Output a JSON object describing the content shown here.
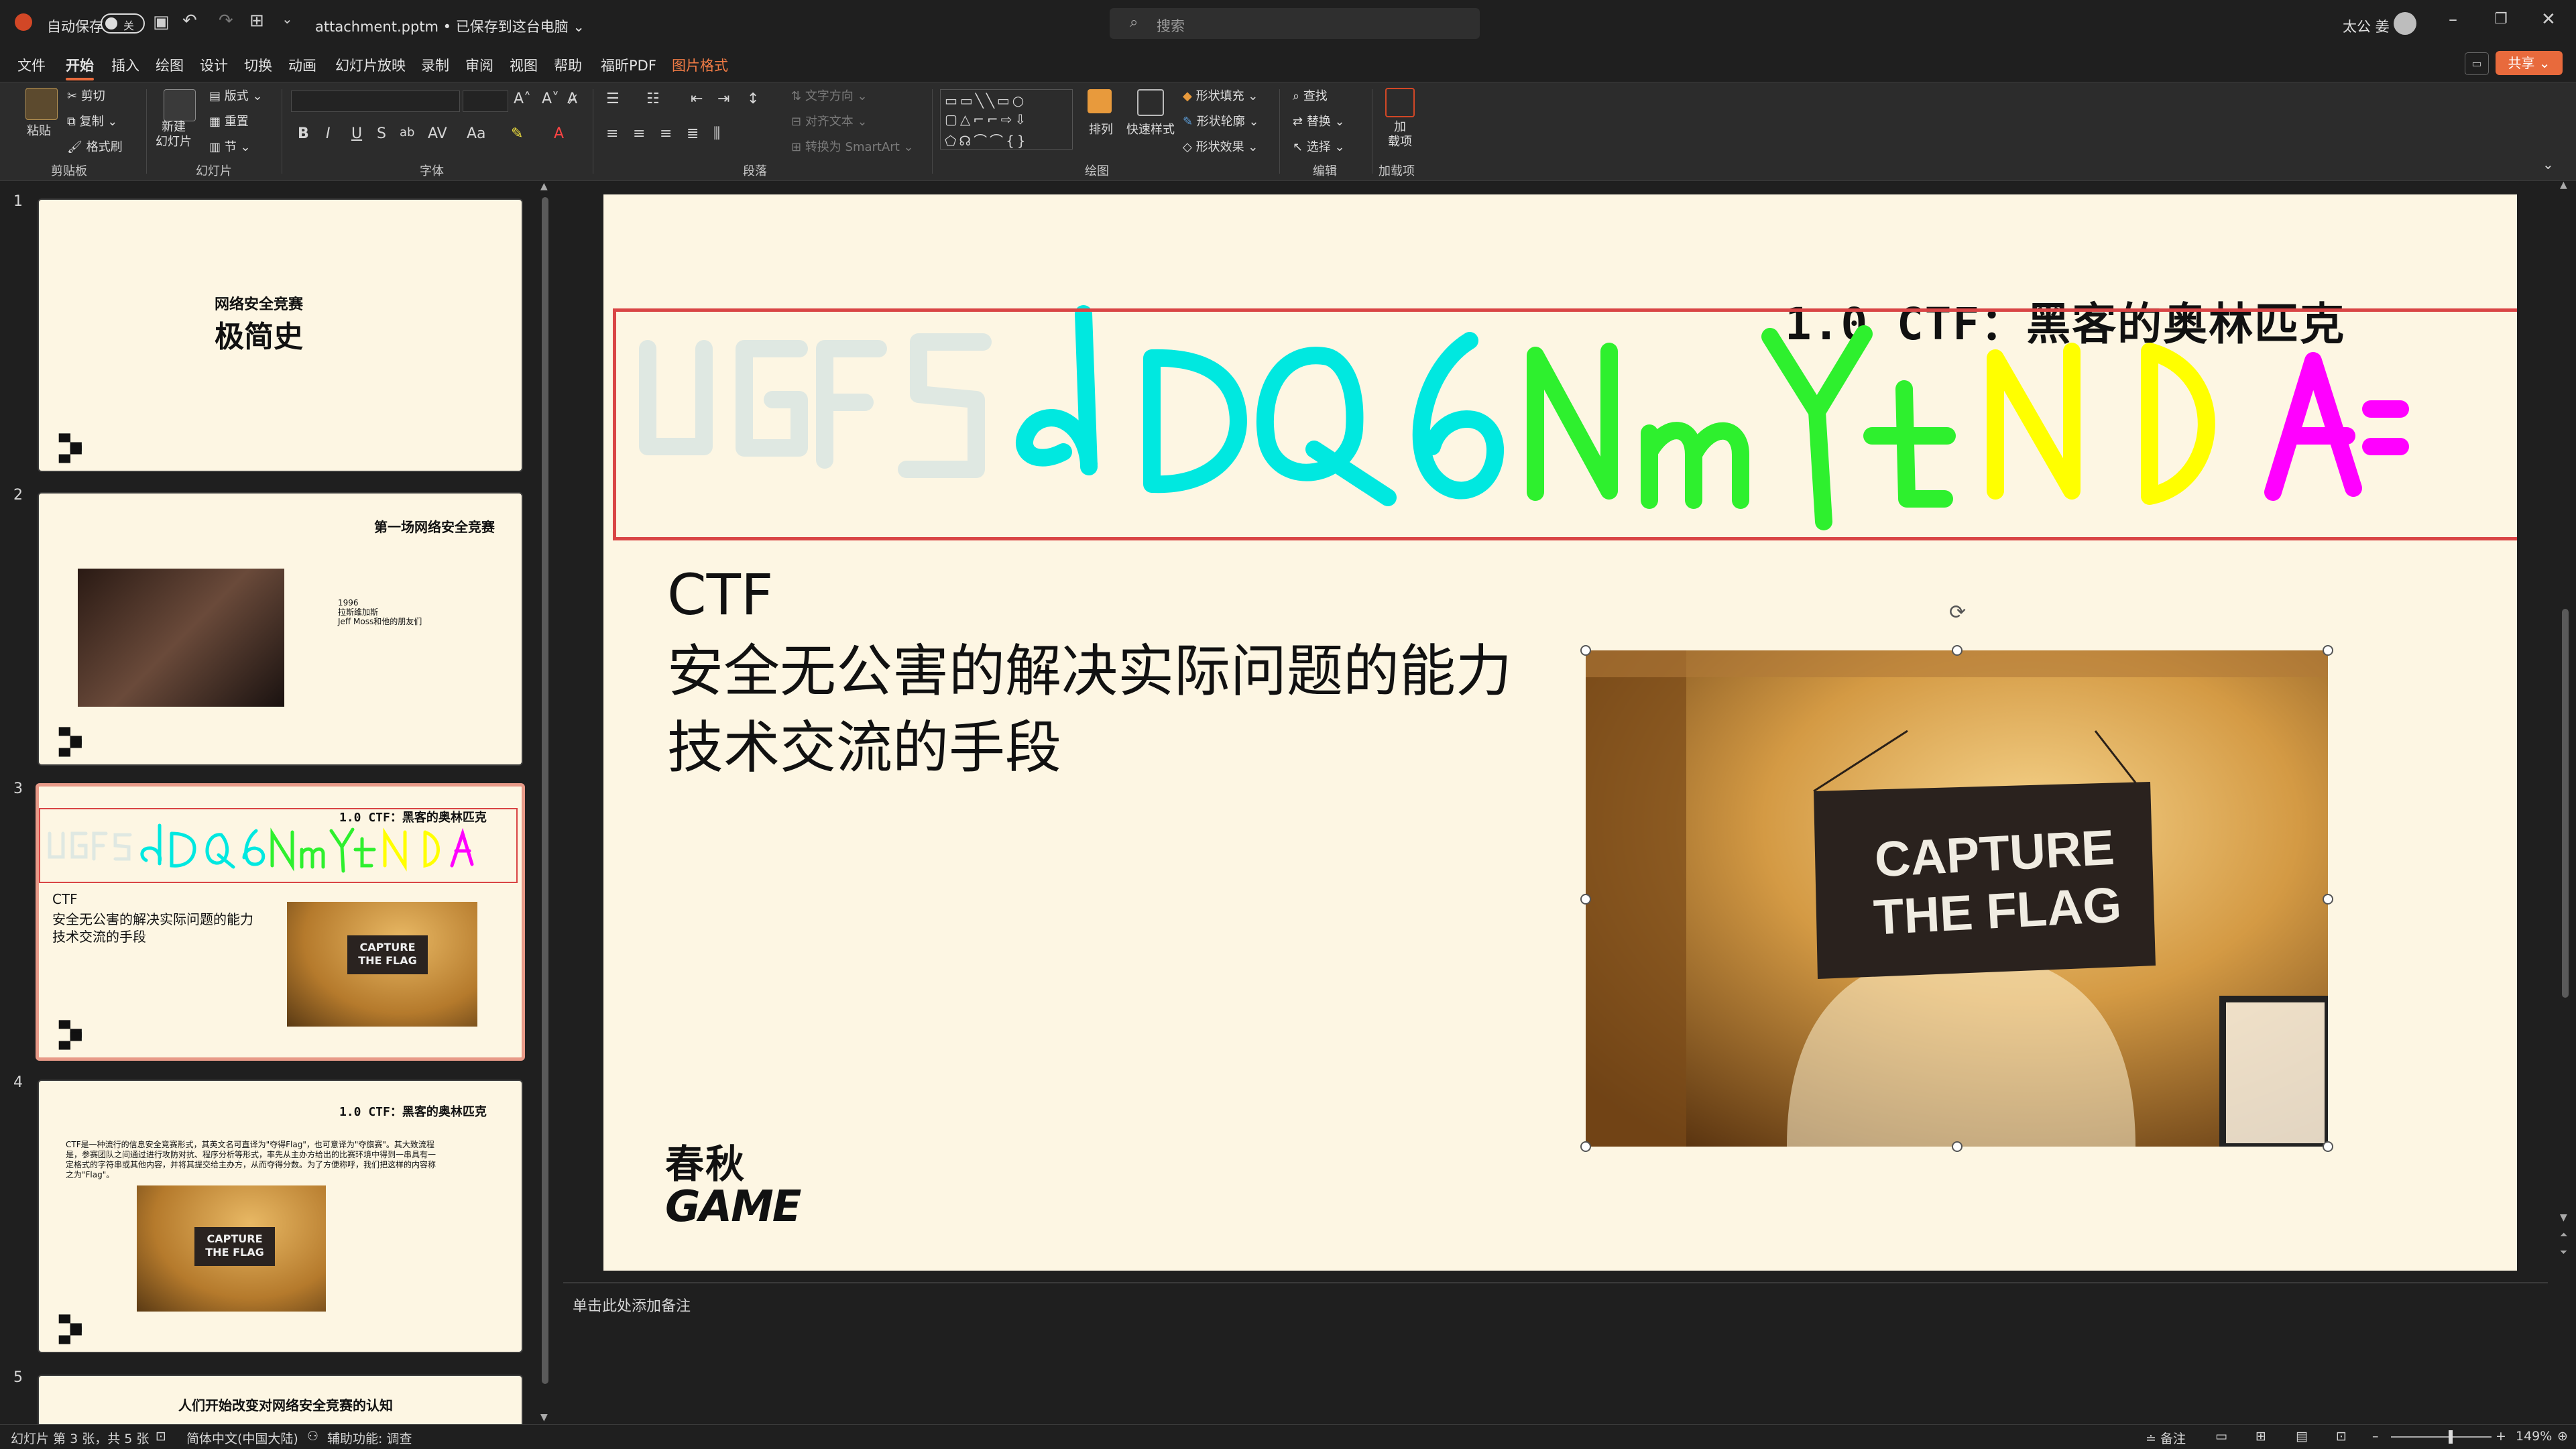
{
  "titlebar": {
    "autosave_label": "自动保存",
    "autosave_state": "关",
    "file_title": "attachment.pptm • 已保存到这台电脑 ⌄",
    "search_placeholder": "搜索",
    "user_name": "太公 姜"
  },
  "menu": {
    "tabs": [
      "文件",
      "开始",
      "插入",
      "绘图",
      "设计",
      "切换",
      "动画",
      "幻灯片放映",
      "录制",
      "审阅",
      "视图",
      "帮助",
      "福昕PDF",
      "图片格式"
    ],
    "active_tab": "开始",
    "share_label": "共享"
  },
  "ribbon": {
    "clipboard": {
      "paste": "粘贴",
      "cut": "剪切",
      "copy": "复制",
      "format_painter": "格式刷",
      "group": "剪贴板"
    },
    "slides": {
      "new_slide": "新建\n幻灯片",
      "layout": "版式",
      "reset": "重置",
      "section": "节",
      "group": "幻灯片"
    },
    "font": {
      "group": "字体",
      "bold": "B",
      "italic": "I",
      "underline": "U",
      "strike": "S"
    },
    "paragraph": {
      "group": "段落",
      "text_direction": "文字方向",
      "align_text": "对齐文本",
      "smartart": "转换为 SmartArt"
    },
    "drawing": {
      "group": "绘图",
      "arrange": "排列",
      "quick_styles": "快速样式",
      "shape_fill": "形状填充",
      "shape_outline": "形状轮廓",
      "shape_effects": "形状效果"
    },
    "editing": {
      "group": "编辑",
      "find": "查找",
      "replace": "替换",
      "select": "选择"
    },
    "addins": {
      "group": "加载项",
      "label": "加\n载项"
    }
  },
  "thumbnails": [
    {
      "num": "1",
      "subtitle": "网络安全竞赛",
      "title": "极简史"
    },
    {
      "num": "2",
      "title": "第一场网络安全竞赛",
      "caption_lines": [
        "1996",
        "拉斯维加斯",
        "Jeff Moss和他的朋友们"
      ]
    },
    {
      "num": "3",
      "title": "1.0  CTF：黑客的奥林匹克",
      "lines": [
        "CTF",
        "安全无公害的解决实际问题的能力",
        "技术交流的手段"
      ],
      "sign": "CAPTURE\nTHE FLAG",
      "doodle": "UGFSdDQ6NmYtNDA="
    },
    {
      "num": "4",
      "title": "1.0  CTF：黑客的奥林匹克",
      "para": "CTF是一种流行的信息安全竞赛形式，其英文名可直译为\"夺得Flag\"，也可意译为\"夺旗赛\"。其大致流程是，参赛团队之间通过进行攻防对抗、程序分析等形式，率先从主办方给出的比赛环境中得到一串具有一定格式的字符串或其他内容，并将其提交给主办方，从而夺得分数。为了方便称呼，我们把这样的内容称之为\"Flag\"。",
      "sign": "CAPTURE\nTHE FLAG"
    },
    {
      "num": "5",
      "title": "人们开始改变对网络安全竞赛的认知"
    }
  ],
  "logo_text": {
    "top": "春秋",
    "bottom": "GAME"
  },
  "slide": {
    "title": "1.0  CTF：黑客的奥林匹克",
    "lines": [
      "CTF",
      "安全无公害的解决实际问题的能力",
      "技术交流的手段"
    ],
    "sign_lines": [
      "CAPTURE",
      "THE FLAG"
    ]
  },
  "notes_placeholder": "单击此处添加备注",
  "statusbar": {
    "slide_info": "幻灯片 第 3 张，共 5 张",
    "language": "简体中文(中国大陆)",
    "accessibility": "辅助功能: 调查",
    "notes_btn": "备注",
    "zoom": "149%"
  },
  "colors": {
    "accent": "#e86a3c",
    "selection": "#d94545",
    "slide_bg": "#fdf6e3"
  }
}
